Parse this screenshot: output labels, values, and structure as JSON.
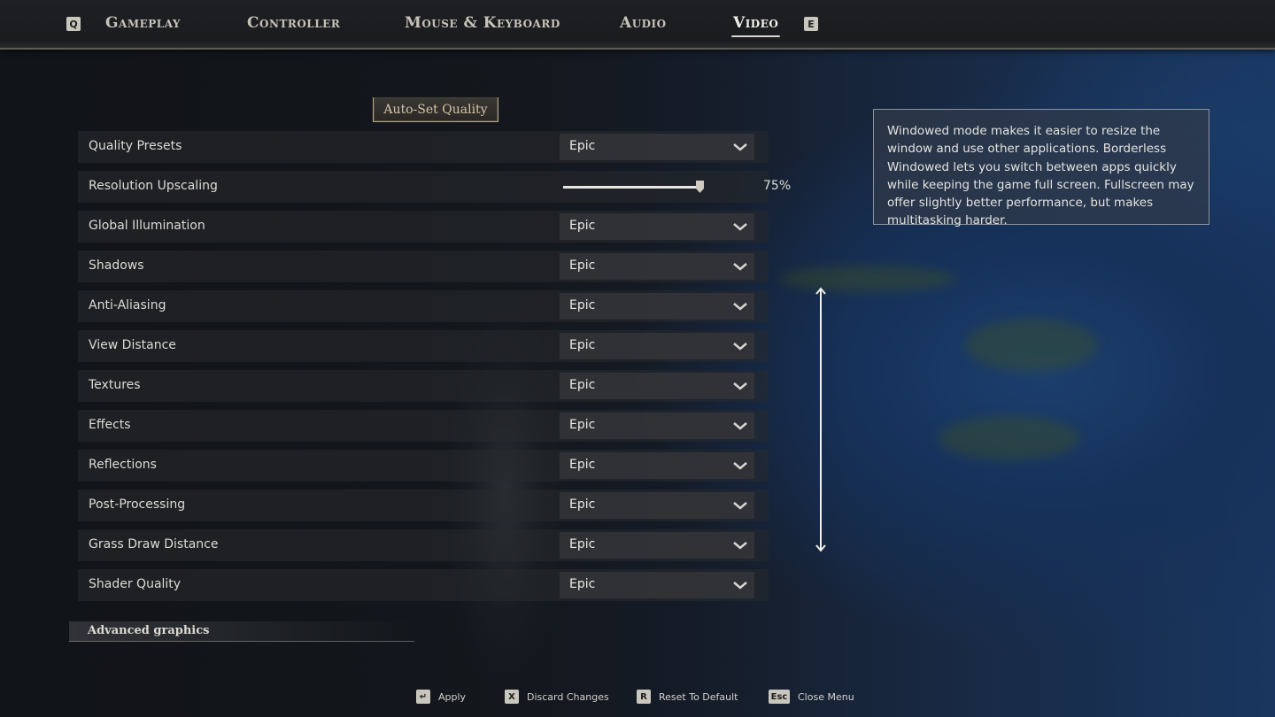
{
  "tabs": {
    "prev_key": "Q",
    "next_key": "E",
    "items": [
      {
        "label": "Gameplay"
      },
      {
        "label": "Controller"
      },
      {
        "label": "Mouse & Keyboard"
      },
      {
        "label": "Audio"
      },
      {
        "label": "Video"
      }
    ],
    "active": "Video"
  },
  "auto_set_label": "Auto-Set Quality",
  "settings": [
    {
      "label": "Quality Presets",
      "value": "Epic"
    },
    {
      "label": "Resolution Upscaling",
      "value": "75%",
      "slider_fraction": 0.75
    },
    {
      "label": "Global Illumination",
      "value": "Epic"
    },
    {
      "label": "Shadows",
      "value": "Epic"
    },
    {
      "label": "Anti-Aliasing",
      "value": "Epic"
    },
    {
      "label": "View Distance",
      "value": "Epic"
    },
    {
      "label": "Textures",
      "value": "Epic"
    },
    {
      "label": "Effects",
      "value": "Epic"
    },
    {
      "label": "Reflections",
      "value": "Epic"
    },
    {
      "label": "Post-Processing",
      "value": "Epic"
    },
    {
      "label": "Grass Draw Distance",
      "value": "Epic"
    },
    {
      "label": "Shader Quality",
      "value": "Epic"
    }
  ],
  "advanced_header": "Advanced graphics",
  "info_text": "Windowed mode makes it easier to resize the window and use other applications. Borderless Windowed lets you switch between apps quickly while keeping the game full screen. Fullscreen may offer slightly better performance, but makes multitasking harder.",
  "footer": [
    {
      "key": "↵",
      "label": "Apply"
    },
    {
      "key": "X",
      "label": "Discard Changes"
    },
    {
      "key": "R",
      "label": "Reset To Default"
    },
    {
      "key": "Esc",
      "label": "Close Menu"
    }
  ]
}
